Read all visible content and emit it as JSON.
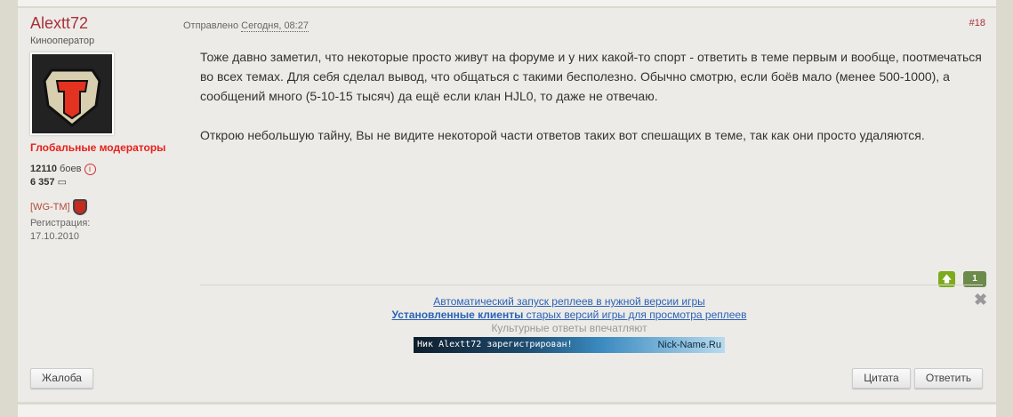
{
  "post": {
    "author": "Alextt72",
    "rank": "Кинооператор",
    "group": "Глобальные модераторы",
    "battles_value": "12110",
    "battles_label": "боев",
    "posts_value": "6 357",
    "clan": "[WG-TM]",
    "reg_label": "Регистрация:",
    "reg_date": "17.10.2010",
    "sent_label": "Отправлено",
    "sent_time": "Сегодня, 08:27",
    "number": "#18",
    "paragraphs": [
      "Тоже давно заметил, что некоторые просто живут на форуме и у них какой-то спорт - ответить в теме первым и вообще, поотмечаться во всех темах. Для себя сделал вывод, что общаться с такими бесполезно. Обычно смотрю, если боёв мало (менее 500-1000), а сообщений много (5-10-15 тысяч) да ещё если клан HJL0, то даже не отвечаю.",
      "Открою небольшую тайну, Вы не видите некоторой части ответов таких вот спешащих в теме, так как они просто удаляются."
    ],
    "vote_count": "1",
    "signature": {
      "link1": "Автоматический запуск реплеев в нужной версии игры",
      "link2_bold": "Установленные клиенты",
      "link2_rest": " старых версий игры для просмотра реплеев",
      "gray": "Культурные ответы впечатляют",
      "banner_text": "Ник Alextt72 зарегистрирован!",
      "banner_site": "Nick-Name.Ru"
    },
    "buttons": {
      "report": "Жалоба",
      "quote": "Цитата",
      "reply": "Ответить"
    }
  }
}
